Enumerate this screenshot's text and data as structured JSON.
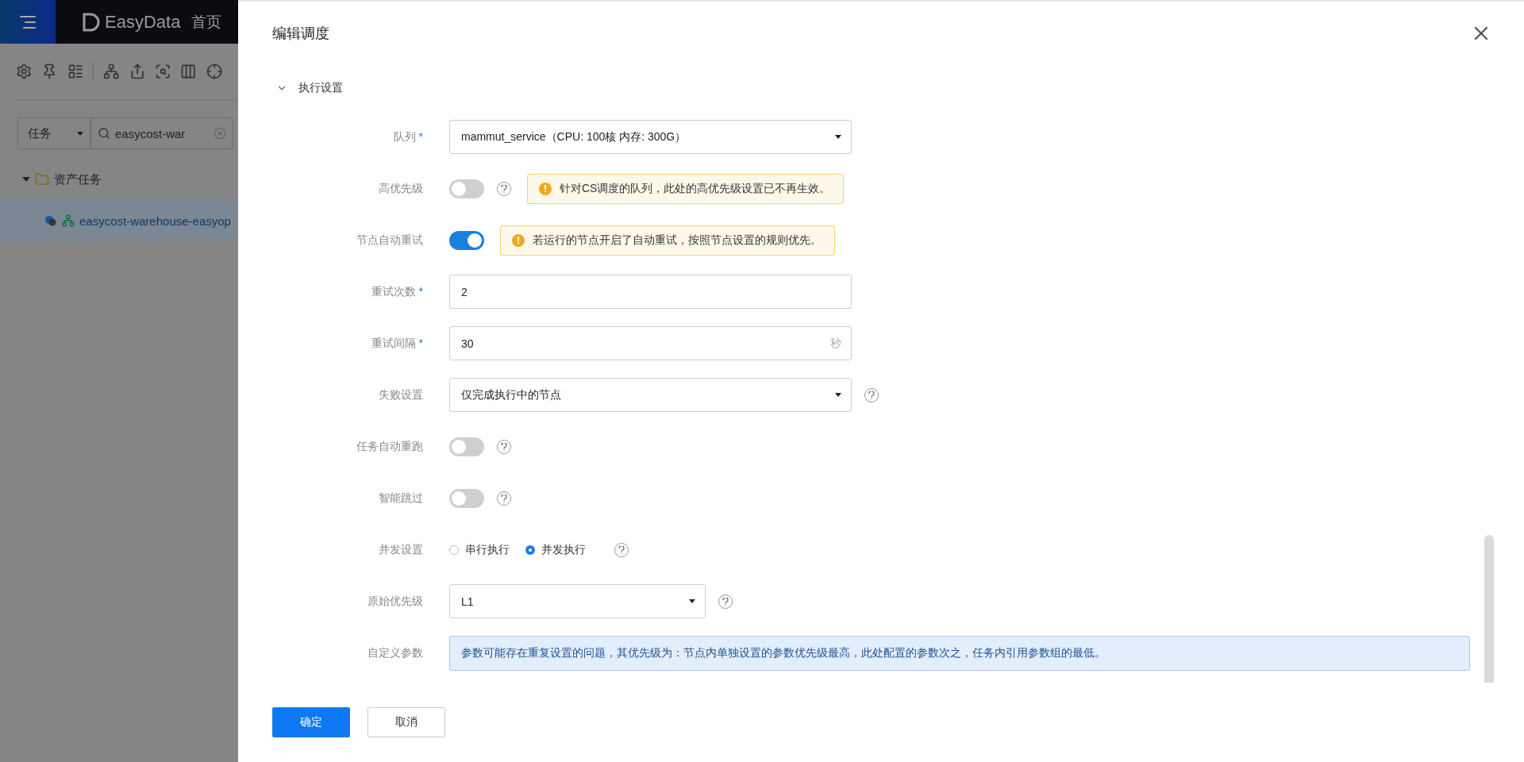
{
  "background_app": {
    "logo": "EasyData",
    "nav": [
      "首页"
    ],
    "filter": {
      "type": "任务",
      "search": "easycost-war"
    },
    "tree": [
      {
        "label": "资产任务",
        "expanded": true,
        "children": [
          {
            "label": "easycost-warehouse-easyop",
            "selected": true
          }
        ]
      }
    ]
  },
  "drawer": {
    "title": "编辑调度",
    "section": {
      "title": "执行设置",
      "expanded": true
    },
    "fields": [
      {
        "kind": "select",
        "label": "队列",
        "required_mark": "*",
        "value": "mammut_service（CPU: 100核 内存: 300G）"
      },
      {
        "kind": "switch",
        "label": "高优先级",
        "on": false,
        "help": true,
        "notice": "针对CS调度的队列，此处的高优先级设置已不再生效。"
      },
      {
        "kind": "switch",
        "label": "节点自动重试",
        "on": true,
        "notice": "若运行的节点开启了自动重试，按照节点设置的规则优先。"
      },
      {
        "kind": "input",
        "label": "重试次数",
        "required_mark": "*",
        "value": "2"
      },
      {
        "kind": "input",
        "label": "重试间隔",
        "required_mark": "*",
        "value": "30",
        "suffix": "秒"
      },
      {
        "kind": "select",
        "label": "失败设置",
        "value": "仅完成执行中的节点",
        "help": true
      },
      {
        "kind": "switch",
        "label": "任务自动重跑",
        "on": false,
        "help": true
      },
      {
        "kind": "switch",
        "label": "智能跳过",
        "on": false,
        "help": true
      },
      {
        "kind": "radio",
        "label": "并发设置",
        "help": true,
        "options": [
          {
            "label": "串行执行",
            "selected": false
          },
          {
            "label": "并发执行",
            "selected": true
          }
        ]
      },
      {
        "kind": "select",
        "label": "原始优先级",
        "value": "L1",
        "help": true,
        "compact": true
      },
      {
        "kind": "notice",
        "label": "自定义参数",
        "text": "参数可能存在重复设置的问题，其优先级为：节点内单独设置的参数优先级最高，此处配置的参数次之，任务内引用参数组的最低。"
      }
    ],
    "buttons": [
      {
        "label": "确定",
        "primary": true
      },
      {
        "label": "取消",
        "primary": false
      }
    ]
  }
}
